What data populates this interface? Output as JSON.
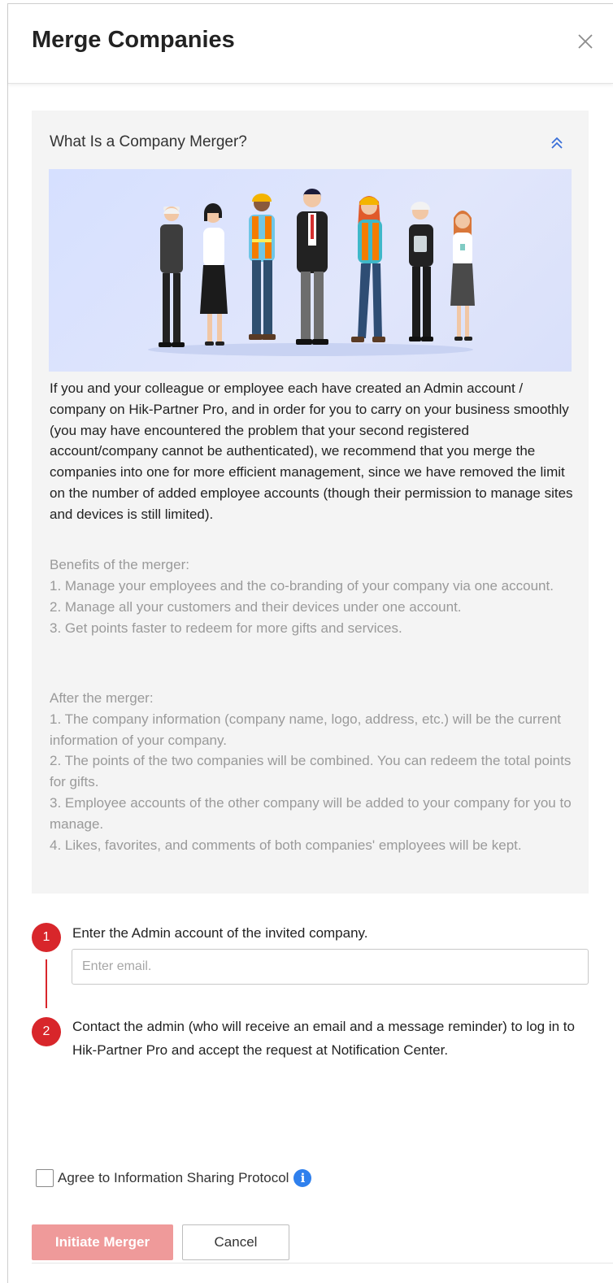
{
  "dialog": {
    "title": "Merge Companies",
    "close_icon": "close-icon"
  },
  "intro": {
    "title": "What Is a Company Merger?",
    "collapse_icon": "double-chevron-up-icon",
    "illustration": "team-of-workers-illustration",
    "description": "If you and your colleague or employee each have created an Admin account / company on Hik-Partner Pro, and in order for you to carry on your business smoothly (you may have encountered the problem that your second registered account/company cannot be authenticated), we recommend that you merge the companies into one for more efficient management, since we have removed the limit on the number of added employee accounts (though their permission to manage sites and devices is still limited).",
    "benefits": [
      "Benefits of the merger:",
      "1. Manage your employees and the co-branding of your company via one account.",
      "2. Manage all your customers and their devices under one account.",
      "3. Get points faster to redeem for more gifts and services."
    ],
    "after": [
      "After the merger:",
      "1. The company information (company name, logo, address, etc.) will be the current information of your company.",
      "2. The points of the two companies will be combined. You can redeem the total points for gifts.",
      "3. Employee accounts of the other company will be added to your company for you to manage.",
      "4. Likes, favorites, and comments of both companies' employees will be kept."
    ]
  },
  "steps": [
    {
      "number": "1",
      "text": "Enter the Admin account of the invited company."
    },
    {
      "number": "2",
      "text": "Contact the admin (who will receive an email and a message reminder) to log in to Hik-Partner Pro and accept the request at Notification Center."
    }
  ],
  "email_input": {
    "value": "",
    "placeholder": "Enter email."
  },
  "agreement": {
    "label": "Agree to Information Sharing Protocol",
    "checked": false,
    "info_icon": "info-icon"
  },
  "buttons": {
    "initiate": "Initiate Merger",
    "cancel": "Cancel"
  },
  "colors": {
    "accent": "#d8262b",
    "disabled_primary": "#ef9a9a",
    "info": "#2f80ed",
    "link_icon": "#3a6fd8"
  }
}
